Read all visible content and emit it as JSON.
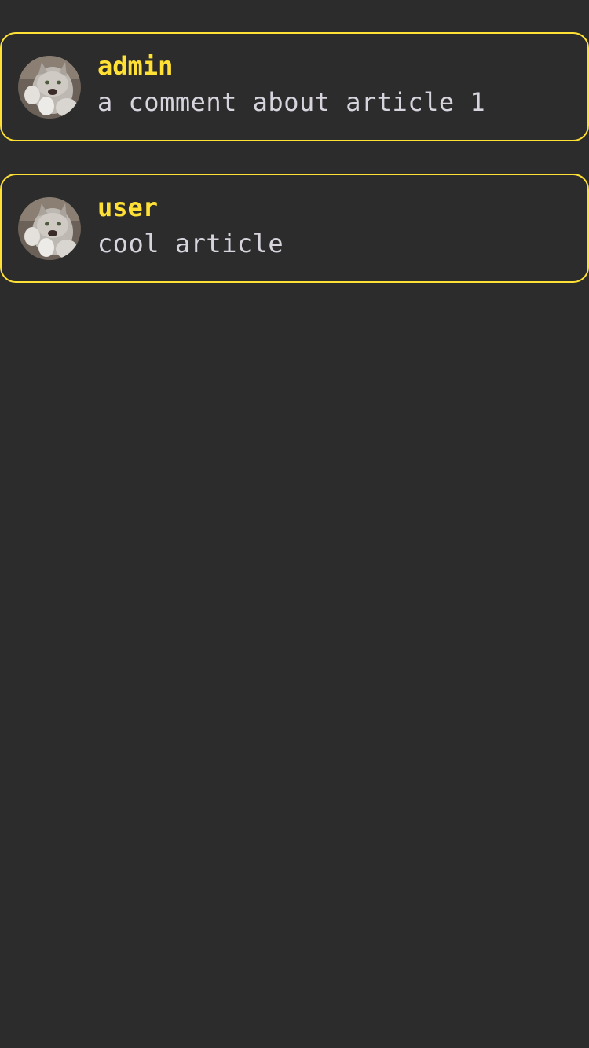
{
  "theme": {
    "background": "#2c2c2c",
    "accent": "#ffe135",
    "text": "#d8d4de"
  },
  "comments": [
    {
      "author": "admin",
      "text": "a comment about article 1",
      "avatar": "cat-avatar-photo"
    },
    {
      "author": "user",
      "text": "cool article",
      "avatar": "cat-avatar-photo"
    }
  ]
}
